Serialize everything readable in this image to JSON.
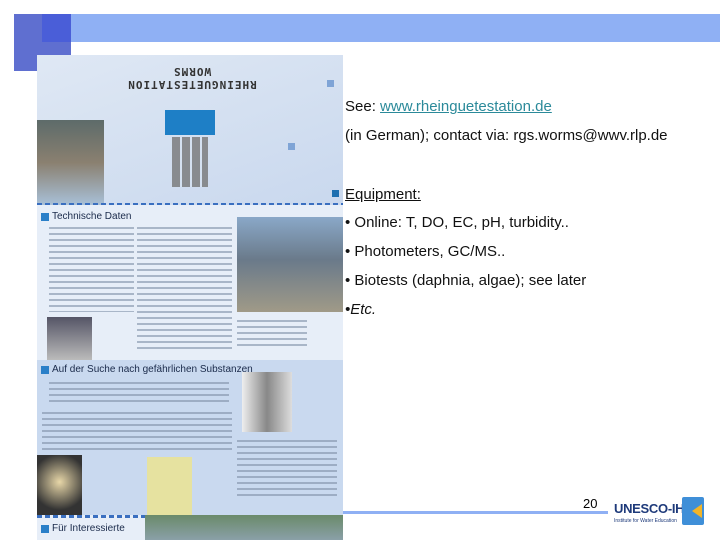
{
  "brochure": {
    "logo_line1": "RHEINGUETESTATION",
    "logo_line2": "WORMS",
    "section1": "Technische Daten",
    "section2": "Auf der Suche nach gefährlichen Substanzen",
    "section3": "Für Interessierte"
  },
  "content": {
    "see_label": "See: ",
    "link": "www.rheinguetestation.de",
    "contact": "(in German);  contact via: rgs.worms@wwv.rlp.de",
    "equipment_heading": "Equipment:",
    "bullets": [
      "• Online: T, DO, EC, pH, turbidity..",
      "• Photometers, GC/MS..",
      "• Biotests (daphnia, algae); see    later"
    ],
    "etc": "•Etc."
  },
  "footer": {
    "page_number": "20",
    "logo_name": "UNESCO-IHE",
    "logo_sub": "Institute for Water Education"
  },
  "colors": {
    "accent": "#8fb0f4",
    "link": "#2b8a9a",
    "bullet": "#1e6fb0"
  }
}
